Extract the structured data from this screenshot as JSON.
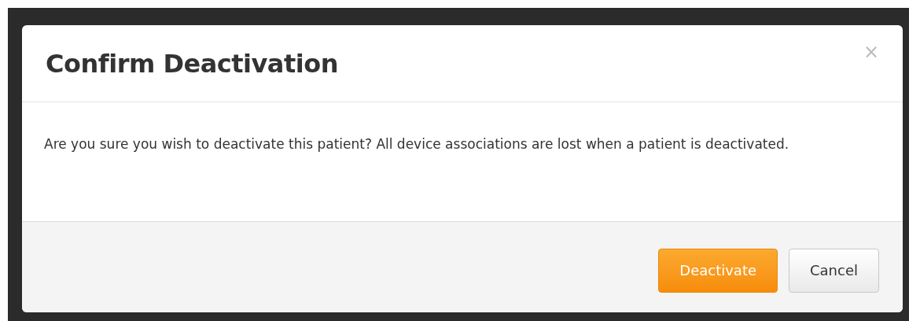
{
  "dialog": {
    "title": "Confirm Deactivation",
    "close": "×",
    "message": "Are you sure you wish to deactivate this patient? All device associations are lost when a patient is deactivated.",
    "buttons": [
      {
        "label": "Deactivate",
        "kind": "primary"
      },
      {
        "label": "Cancel",
        "kind": "default"
      }
    ]
  }
}
